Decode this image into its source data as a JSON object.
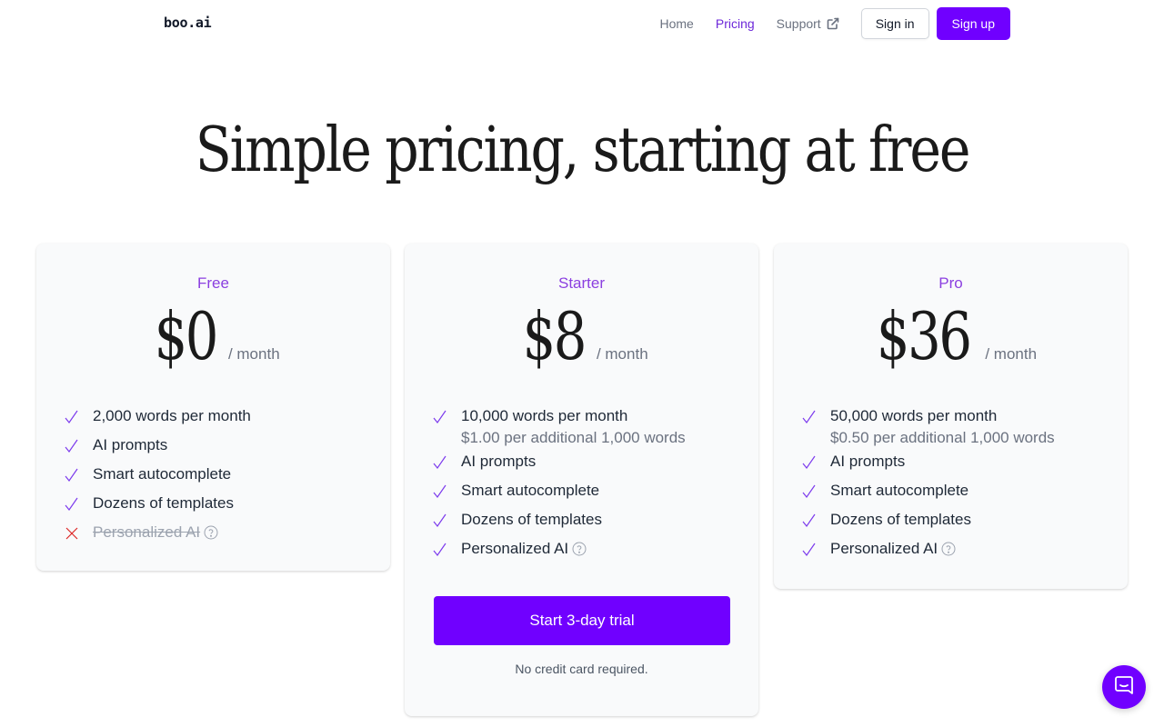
{
  "nav": {
    "logo": "boo.ai",
    "links": [
      {
        "label": "Home"
      },
      {
        "label": "Pricing",
        "active": true
      },
      {
        "label": "Support",
        "icon": "external-link-icon"
      }
    ],
    "sign_in": "Sign in",
    "sign_up": "Sign up"
  },
  "hero": {
    "title": "Simple pricing, starting at free"
  },
  "plans": [
    {
      "name": "Free",
      "price": "$0",
      "period": "/ month",
      "features": [
        {
          "label": "2,000 words per month",
          "included": true
        },
        {
          "label": "AI prompts",
          "included": true
        },
        {
          "label": "Smart autocomplete",
          "included": true
        },
        {
          "label": "Dozens of templates",
          "included": true
        },
        {
          "label": "Personalized AI",
          "included": false,
          "help": true
        }
      ]
    },
    {
      "name": "Starter",
      "price": "$8",
      "period": "/ month",
      "features": [
        {
          "label": "10,000 words per month",
          "sub": "$1.00 per additional 1,000 words",
          "included": true
        },
        {
          "label": "AI prompts",
          "included": true
        },
        {
          "label": "Smart autocomplete",
          "included": true
        },
        {
          "label": "Dozens of templates",
          "included": true
        },
        {
          "label": "Personalized AI",
          "included": true,
          "help": true
        }
      ],
      "cta": "Start 3-day trial",
      "cta_note": "No credit card required."
    },
    {
      "name": "Pro",
      "price": "$36",
      "period": "/ month",
      "features": [
        {
          "label": "50,000 words per month",
          "sub": "$0.50 per additional 1,000 words",
          "included": true
        },
        {
          "label": "AI prompts",
          "included": true
        },
        {
          "label": "Smart autocomplete",
          "included": true
        },
        {
          "label": "Dozens of templates",
          "included": true
        },
        {
          "label": "Personalized AI",
          "included": true,
          "help": true
        }
      ]
    }
  ],
  "colors": {
    "accent": "#7000ff",
    "plan_name": "#8b3fe0",
    "check": "#7c3aed",
    "cross": "#dc2626"
  },
  "chat_widget": {
    "icon": "chat-icon"
  }
}
